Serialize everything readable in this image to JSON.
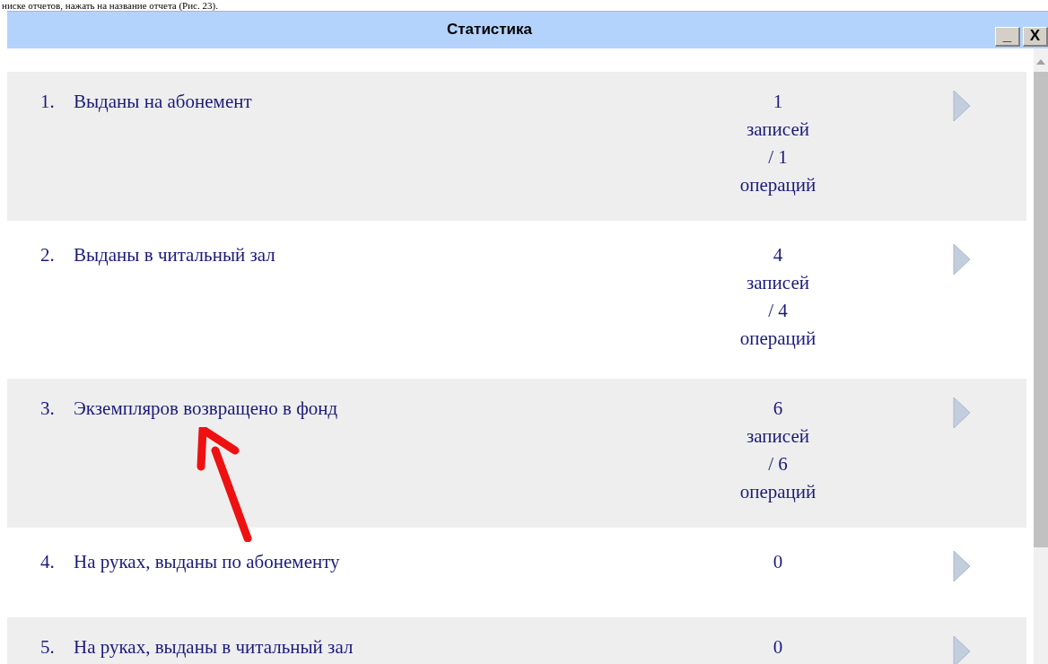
{
  "document_text": "ниске отчетов, нажать на название отчета (Рис. 23).",
  "window": {
    "title": "Статистика",
    "buttons": [
      "_",
      "X"
    ]
  },
  "reports": [
    {
      "number": "1.",
      "label": "Выданы на абонемент",
      "count_lines": [
        "1",
        "записей",
        "/ 1",
        "операций"
      ]
    },
    {
      "number": "2.",
      "label": "Выданы в читальный зал",
      "count_lines": [
        "4",
        "записей",
        "/ 4",
        "операций"
      ]
    },
    {
      "number": "3.",
      "label": "Экземпляров возвращено в фонд",
      "count_lines": [
        "6",
        "записей",
        "/ 6",
        "операций"
      ]
    },
    {
      "number": "4.",
      "label": "На руках, выданы по абонементу",
      "count_lines": [
        "0"
      ]
    },
    {
      "number": "5.",
      "label": "На руках, выданы в читальный зал",
      "count_lines": [
        "0"
      ]
    }
  ]
}
